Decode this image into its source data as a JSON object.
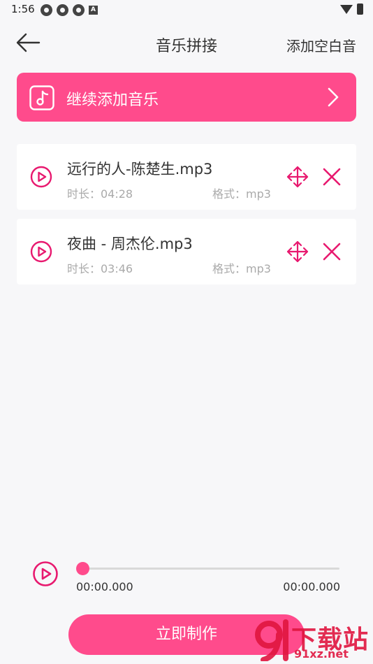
{
  "status_bar": {
    "time": "1:56"
  },
  "header": {
    "title": "音乐拼接",
    "add_blank_label": "添加空白音"
  },
  "add_music": {
    "label": "继续添加音乐"
  },
  "tracks": [
    {
      "name": "远行的人-陈楚生.mp3",
      "duration": "时长：04:28",
      "format": "格式：mp3"
    },
    {
      "name": "夜曲 - 周杰伦.mp3",
      "duration": "时长：03:46",
      "format": "格式：mp3"
    }
  ],
  "player": {
    "current_time": "00:00.000",
    "total_time": "00:00.000",
    "progress": 0
  },
  "make_button": {
    "label": "立即制作"
  },
  "watermark": {
    "text": "下载站",
    "site": "91xz.net"
  },
  "colors": {
    "accent": "#ff4b8c",
    "background": "#f7f7f9"
  }
}
